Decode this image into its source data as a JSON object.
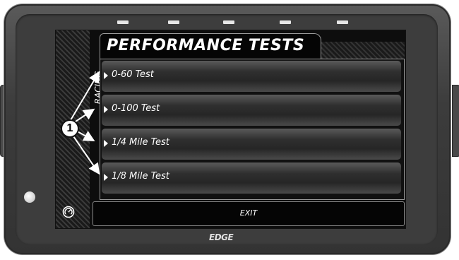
{
  "screen": {
    "title": "PERFORMANCE TESTS",
    "category_label": "RACING",
    "menu_items": [
      {
        "label": "0-60 Test"
      },
      {
        "label": "0-100 Test"
      },
      {
        "label": "1/4 Mile Test"
      },
      {
        "label": "1/8 Mile Test"
      }
    ],
    "exit_label": "EXIT"
  },
  "device": {
    "brand": "EDGE",
    "led_count": 5
  },
  "callout": {
    "number": "1"
  },
  "colors": {
    "bezel": "#3d3d3d",
    "screen_bg": "#0d0d0d",
    "text": "#ffffff",
    "led": "#e6e6e6"
  }
}
